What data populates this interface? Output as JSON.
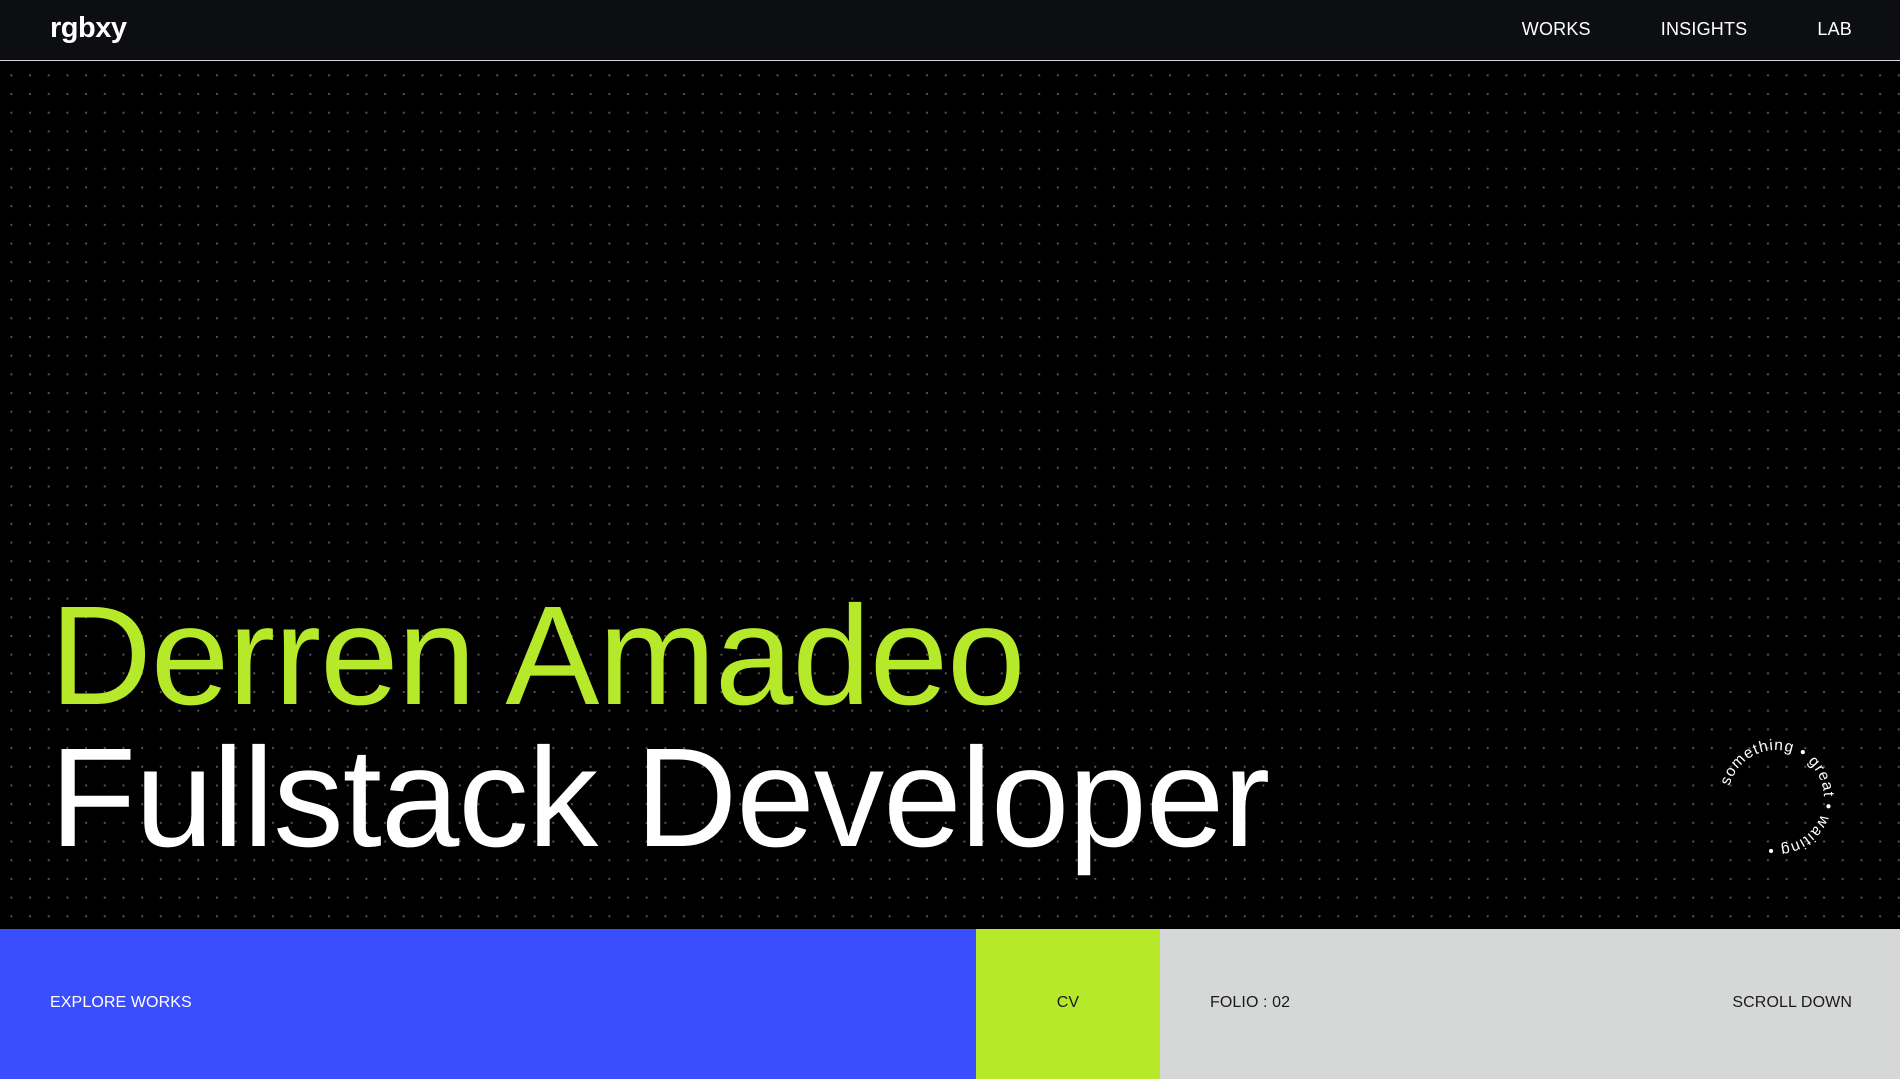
{
  "header": {
    "logo": "rgbxy",
    "nav": [
      "WORKS",
      "INSIGHTS",
      "LAB"
    ]
  },
  "hero": {
    "name": "Derren Amadeo",
    "role": "Fullstack Developer",
    "badge_text": "something • great • waiting •"
  },
  "footer": {
    "explore_label": "EXPLORE WORKS",
    "cv_label": "CV",
    "folio_label": "FOLIO : 02",
    "scroll_label": "SCROLL DOWN"
  },
  "colors": {
    "background": "#000000",
    "topbar": "#0d0e11",
    "accent_green": "#b7e92b",
    "accent_blue": "#3b4efe",
    "panel_grey": "#d5d8d6"
  }
}
